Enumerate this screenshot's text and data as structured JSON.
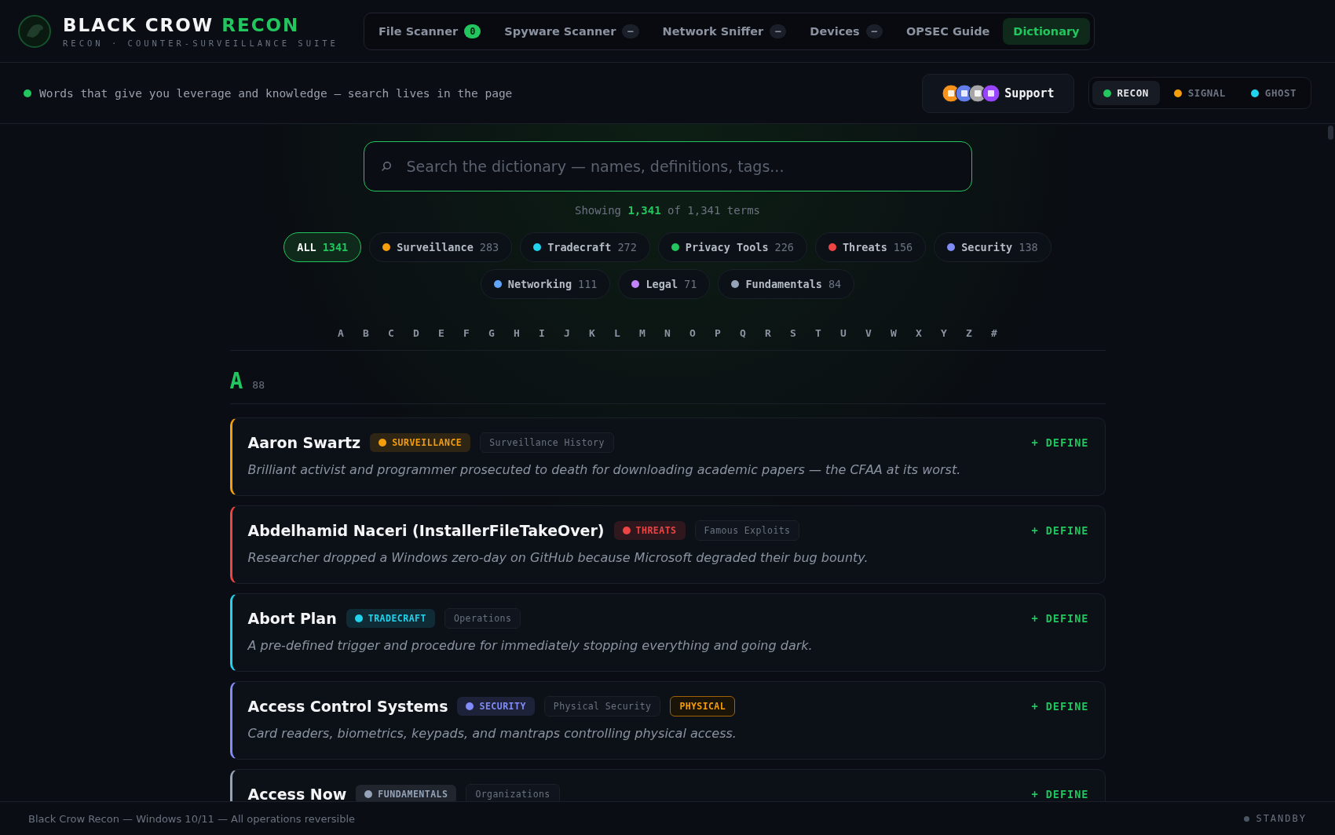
{
  "brand": {
    "title_main": "BLACK CROW",
    "title_accent": "RECON",
    "subtitle": "RECON · COUNTER-SURVEILLANCE SUITE"
  },
  "nav_tabs": [
    {
      "label": "File Scanner",
      "badge": "0",
      "kind": "count",
      "selected": false
    },
    {
      "label": "Spyware Scanner",
      "badge": "–",
      "kind": "idle",
      "selected": false
    },
    {
      "label": "Network Sniffer",
      "badge": "–",
      "kind": "idle",
      "selected": false
    },
    {
      "label": "Devices",
      "badge": "–",
      "kind": "idle",
      "selected": false
    },
    {
      "label": "OPSEC Guide",
      "selected": false
    },
    {
      "label": "Dictionary",
      "selected": true
    }
  ],
  "tagline": "Words that give you leverage and knowledge — search lives in the page",
  "support_button": {
    "label": "Support"
  },
  "themes": [
    {
      "label": "RECON",
      "color": "#22c55e",
      "selected": true
    },
    {
      "label": "SIGNAL",
      "color": "#f59e0b",
      "selected": false
    },
    {
      "label": "GHOST",
      "color": "#22d3ee",
      "selected": false
    }
  ],
  "search": {
    "placeholder": "Search the dictionary — names, definitions, tags..."
  },
  "result_count": "Showing **1,341** of 1,341 terms",
  "categories": [
    {
      "label": "ALL",
      "count": "1341",
      "selected": true
    },
    {
      "label": "Surveillance",
      "count": "283",
      "color": "#f59e0b",
      "selected": false
    },
    {
      "label": "Tradecraft",
      "count": "272",
      "color": "#22d3ee",
      "selected": false
    },
    {
      "label": "Privacy Tools",
      "count": "226",
      "color": "#22c55e",
      "selected": false
    },
    {
      "label": "Threats",
      "count": "156",
      "color": "#ef4444",
      "selected": false
    },
    {
      "label": "Security",
      "count": "138",
      "color": "#818cf8",
      "selected": false
    },
    {
      "label": "Networking",
      "count": "111",
      "color": "#60a5fa",
      "selected": false
    },
    {
      "label": "Legal",
      "count": "71",
      "color": "#c084fc",
      "selected": false
    },
    {
      "label": "Fundamentals",
      "count": "84",
      "color": "#94a3b8",
      "selected": false
    }
  ],
  "alphabet": [
    "A",
    "B",
    "C",
    "D",
    "E",
    "F",
    "G",
    "H",
    "I",
    "J",
    "K",
    "L",
    "M",
    "N",
    "O",
    "P",
    "Q",
    "R",
    "S",
    "T",
    "U",
    "V",
    "W",
    "X",
    "Y",
    "Z",
    "#"
  ],
  "section": {
    "letter": "A",
    "count": "88"
  },
  "terms": [
    {
      "name": "Aaron Swartz",
      "category": "SURVEILLANCE",
      "color": "#f59e0b",
      "tags": [
        {
          "label": "Surveillance History",
          "kind": "plain"
        }
      ],
      "definition": "Brilliant activist and programmer prosecuted to death for downloading academic papers — the CFAA at its worst.",
      "action": "+ DEFINE"
    },
    {
      "name": "Abdelhamid Naceri (InstallerFileTakeOver)",
      "category": "THREATS",
      "color": "#ef4444",
      "tags": [
        {
          "label": "Famous Exploits",
          "kind": "plain"
        }
      ],
      "definition": "Researcher dropped a Windows zero-day on GitHub because Microsoft degraded their bug bounty.",
      "action": "+ DEFINE"
    },
    {
      "name": "Abort Plan",
      "category": "TRADECRAFT",
      "color": "#22d3ee",
      "tags": [
        {
          "label": "Operations",
          "kind": "plain"
        }
      ],
      "definition": "A pre-defined trigger and procedure for immediately stopping everything and going dark.",
      "action": "+ DEFINE"
    },
    {
      "name": "Access Control Systems",
      "category": "SECURITY",
      "color": "#818cf8",
      "tags": [
        {
          "label": "Physical Security",
          "kind": "plain"
        },
        {
          "label": "PHYSICAL",
          "kind": "highlight"
        }
      ],
      "definition": "Card readers, biometrics, keypads, and mantraps controlling physical access.",
      "action": "+ DEFINE"
    },
    {
      "name": "Access Now",
      "category": "FUNDAMENTALS",
      "color": "#94a3b8",
      "tags": [
        {
          "label": "Organizations",
          "kind": "plain"
        }
      ],
      "action": "+ DEFINE"
    }
  ],
  "footer": {
    "text": "Black Crow Recon — Windows 10/11 — All operations reversible",
    "status": "STANDBY"
  }
}
